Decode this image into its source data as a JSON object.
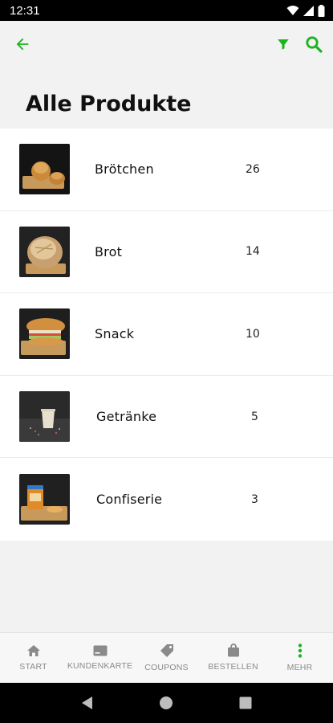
{
  "status_bar": {
    "time": "12:31"
  },
  "app_bar": {
    "back_icon": "arrow-left-icon",
    "filter_icon": "filter-icon",
    "search_icon": "search-icon",
    "accent": "#1db31d"
  },
  "page": {
    "title": "Alle Produkte"
  },
  "categories": [
    {
      "name": "Brötchen",
      "count": "26",
      "image": "rolls"
    },
    {
      "name": "Brot",
      "count": "14",
      "image": "bread"
    },
    {
      "name": "Snack",
      "count": "10",
      "image": "sandwich"
    },
    {
      "name": "Getränke",
      "count": "5",
      "image": "cup"
    },
    {
      "name": "Confiserie",
      "count": "3",
      "image": "jar"
    }
  ],
  "bottom_nav": [
    {
      "label": "START",
      "icon": "home-icon"
    },
    {
      "label": "KUNDENKARTE",
      "icon": "card-icon"
    },
    {
      "label": "COUPONS",
      "icon": "tag-icon"
    },
    {
      "label": "BESTELLEN",
      "icon": "bag-icon"
    },
    {
      "label": "MEHR",
      "icon": "more-vertical-icon",
      "active": true
    }
  ]
}
